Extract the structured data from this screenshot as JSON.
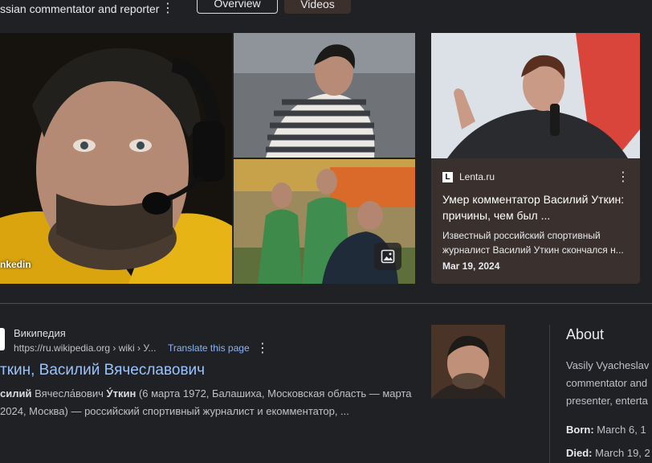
{
  "header": {
    "subtitle": "ssian commentator and reporter",
    "tabs": [
      {
        "label": "Overview",
        "active": true
      },
      {
        "label": "Videos",
        "active": false
      }
    ]
  },
  "images": {
    "main_source": "nkedin"
  },
  "news": {
    "source": "Lenta.ru",
    "logo_letter": "L",
    "title": "Умер комментатор Василий Уткин: причины, чем был ...",
    "snippet": "Известный российский спортивный журналист Василий Уткин скончался н...",
    "date": "Mar 19, 2024"
  },
  "wiki": {
    "site": "Википедия",
    "url": "https://ru.wikipedia.org › wiki › У...",
    "translate": "Translate this page",
    "title": "ткин, Василий Вячеславович",
    "snippet_name": "силий",
    "snippet_mid": " Вячесла́вович ",
    "snippet_surname": "У́ткин",
    "snippet_rest": " (6 марта 1972, Балашиха, Московская область — марта 2024, Москва) — российский спортивный журналист и екомментатор, ..."
  },
  "about": {
    "heading": "About",
    "description_lines": [
      "Vasily Vyacheslav",
      "commentator and",
      "presenter, enterta"
    ],
    "born_label": "Born:",
    "born_value": " March 6, 1",
    "died_label": "Died:",
    "died_value": " March 19, 2"
  },
  "colors": {
    "background": "#202124",
    "card": "#3a302e",
    "link": "#99c3ff",
    "translate_link": "#8ab4f8"
  }
}
